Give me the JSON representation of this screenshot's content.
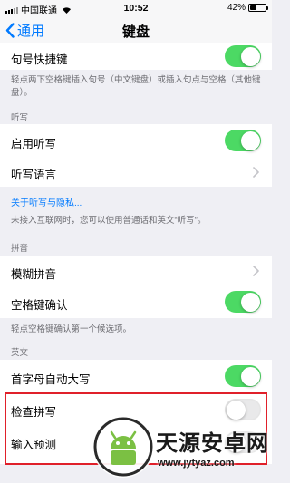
{
  "status_bar": {
    "carrier": "中国联通",
    "network": "令",
    "time": "10:52",
    "battery": "42%",
    "battery_level": 0.42
  },
  "nav": {
    "back_label": "通用",
    "title": "键盘"
  },
  "rows": {
    "period_shortcut": {
      "label": "句号快捷键",
      "on": true
    },
    "period_note": "轻点两下空格键插入句号（中文键盘）或插入句点与空格（其他键盘）。",
    "dictation_header": "听写",
    "enable_dictation": {
      "label": "启用听写",
      "on": true
    },
    "dictation_languages": {
      "label": "听写语言"
    },
    "privacy_link": "关于听写与隐私...",
    "dictation_note": "未接入互联网时，您可以使用普通话和英文“听写”。",
    "pinyin_header": "拼音",
    "fuzzy_pinyin": {
      "label": "模糊拼音"
    },
    "space_confirm": {
      "label": "空格键确认",
      "on": true
    },
    "space_note": "轻点空格键确认第一个候选项。",
    "english_header": "英文",
    "auto_capitalization": {
      "label": "首字母自动大写",
      "on": true
    },
    "check_spelling": {
      "label": "检查拼写",
      "on": false
    },
    "predictive": {
      "label": "输入预测",
      "on": false
    }
  },
  "watermark": {
    "name": "天源安卓网",
    "url": "www.jytyaz.com"
  },
  "colors": {
    "accent": "#007aff",
    "toggle_on": "#4cd964",
    "highlight": "#e0202a",
    "background": "#efeff4"
  }
}
